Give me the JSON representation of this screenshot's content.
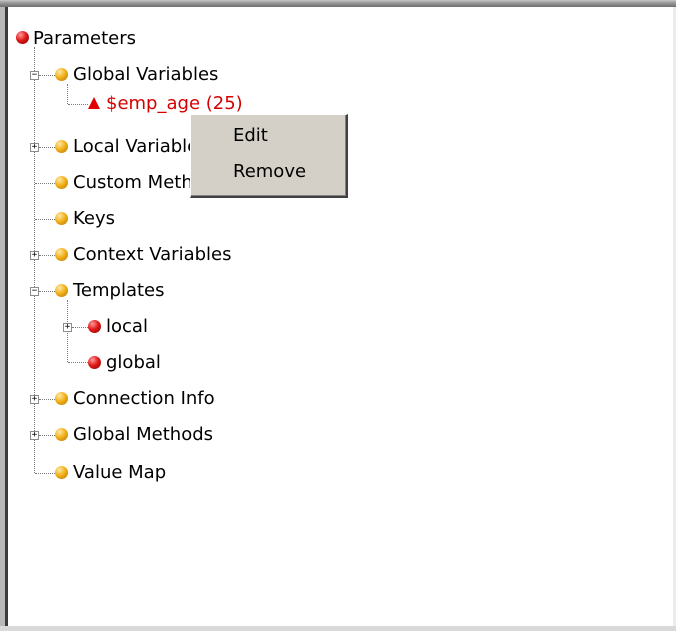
{
  "tree": {
    "root": {
      "label": "Parameters",
      "icon": "red-ball-icon"
    },
    "global_variables": {
      "label": "Global Variables",
      "expander": "−"
    },
    "emp_age": {
      "label": "$emp_age (25)",
      "icon": "warning-triangle-icon"
    },
    "local_variables": {
      "label": "Local Variables",
      "expander": "+"
    },
    "custom_methods": {
      "label": "Custom Methods"
    },
    "keys": {
      "label": "Keys"
    },
    "context_variables": {
      "label": "Context Variables",
      "expander": "+"
    },
    "templates": {
      "label": "Templates",
      "expander": "−"
    },
    "templates_local": {
      "label": "local",
      "expander": "+"
    },
    "templates_global": {
      "label": "global"
    },
    "connection_info": {
      "label": "Connection Info",
      "expander": "+"
    },
    "global_methods": {
      "label": "Global Methods",
      "expander": "+"
    },
    "value_map": {
      "label": "Value Map"
    }
  },
  "context_menu": {
    "edit": "Edit",
    "remove": "Remove"
  },
  "colors": {
    "ball_gold": "#f2b21a",
    "ball_red": "#e11b1b",
    "warning_red": "#e00000",
    "menu_bg": "#d4d0c8"
  }
}
